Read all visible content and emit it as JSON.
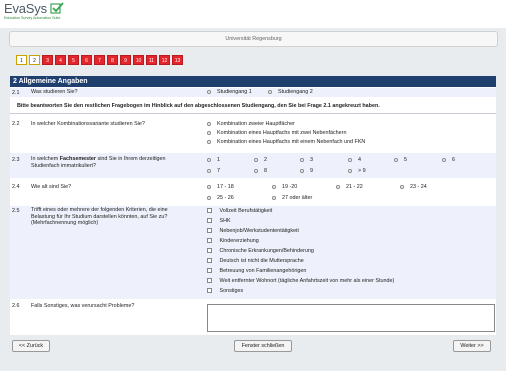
{
  "header": {
    "app_name": "EvaSys",
    "tagline": "Education Survey Automation Suite",
    "university": "Universität Regensburg"
  },
  "pagination": {
    "pages": [
      "1",
      "2",
      "3",
      "4",
      "5",
      "6",
      "7",
      "8",
      "9",
      "10",
      "11",
      "12",
      "13"
    ],
    "current": "2"
  },
  "section": {
    "title": "2  Allgemeine Angaben"
  },
  "q21": {
    "num": "2.1",
    "text": "Was studieren Sie?",
    "options": [
      "Studiengang 1",
      "Studiengang 2"
    ]
  },
  "instruction": "Bitte beantworten Sie den restlichen Fragebogen im Hinblick auf den abgeschlossenen Studiengang, den Sie bei Frage 2.1 angekreuzt haben.",
  "q22": {
    "num": "2.2",
    "text": "In welcher Kombinationsvariante studieren Sie?",
    "options": [
      "Kombination zweier Hauptfächer",
      "Kombination eines Hauptfachs mit zwei Nebenfächern",
      "Kombination eines Hauptfachs mit einem Nebenfach und FKN"
    ]
  },
  "q23": {
    "num": "2.3",
    "text_a": "In welchem ",
    "text_bold": "Fachsemester",
    "text_b": " sind Sie in Ihrem derzeitigen",
    "text_line2": "Studienfach immatrikuliert?",
    "options": [
      "1",
      "2",
      "3",
      "4",
      "5",
      "6",
      "7",
      "8",
      "9",
      "> 9"
    ]
  },
  "q24": {
    "num": "2.4",
    "text": "Wie alt sind Sie?",
    "options": [
      "17 - 18",
      "19 -20",
      "21 - 22",
      "23 - 24",
      "25 - 26",
      "27 oder älter"
    ]
  },
  "q25": {
    "num": "2.5",
    "line1": "Trifft eines oder mehrere der folgenden Kriterien, die eine",
    "line2": "Belastung für Ihr Studium darstellen könnten, auf Sie zu?",
    "line3": "(Mehrfachnennung möglich)",
    "options": [
      "Vollzeit Berufstätigkeit",
      "SHK",
      "Nebenjob/Werkstudententätigkeit",
      "Kindererziehung",
      "Chronische Erkrankungen/Behinderung",
      "Deutsch ist nicht die Muttersprache",
      "Betreuung von Familienangehörigen",
      "Weit entfernter Wohnort (tägliche Anfahrtszeit von mehr als einer Stunde)",
      "Sonstiges"
    ]
  },
  "q26": {
    "num": "2.6",
    "text": "Falls Sonstiges, was verursacht Probleme?"
  },
  "buttons": {
    "back": "<< Zurück",
    "close": "Fenster schließen",
    "next": "Weiter >>"
  },
  "colors": {
    "section_header": "#1f3f6e",
    "page_tab": "#e4262c",
    "logo_check": "#3aa655"
  }
}
